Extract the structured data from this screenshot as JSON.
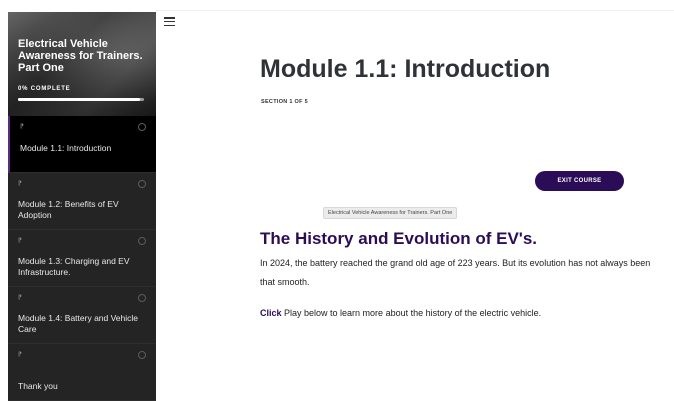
{
  "sidebar": {
    "course_title": "Electrical Vehicle Awareness for Trainers. Part One",
    "progress_text": "0% COMPLETE",
    "progress_fraction": 0.97,
    "lessons": [
      {
        "type_icon": "⁋",
        "label": "Module 1.1: Introduction",
        "active": true
      },
      {
        "type_icon": "⁋",
        "label": "Module 1.2: Benefits of EV Adoption",
        "active": false
      },
      {
        "type_icon": "⁋",
        "label": "Module 1.3: Charging and EV Infrastructure.",
        "active": false
      },
      {
        "type_icon": "⁋",
        "label": "Module 1.4: Battery and Vehicle Care",
        "active": false
      },
      {
        "type_icon": "⁋",
        "label": "Thank you",
        "active": false
      }
    ]
  },
  "header": {
    "menu_icon": "hamburger-menu-icon"
  },
  "main": {
    "module_title": "Module 1.1: Introduction",
    "section_indicator": "SECTION 1 OF 5",
    "exit_label": "EXIT COURSE",
    "tooltip": "Electrical Vehicle Awareness for Trainers. Part One",
    "heading": "The History and Evolution of EV's.",
    "body": "In 2024, the battery reached the grand old age of 223 years. But its evolution has not always been that smooth.",
    "instruction_lead": "Click",
    "instruction_rest": " Play below to learn more about the history of the electric vehicle."
  },
  "colors": {
    "accent": "#2b0d57",
    "sidebar_bg": "#1e1e1e",
    "active_lesson_bg": "#000000"
  }
}
